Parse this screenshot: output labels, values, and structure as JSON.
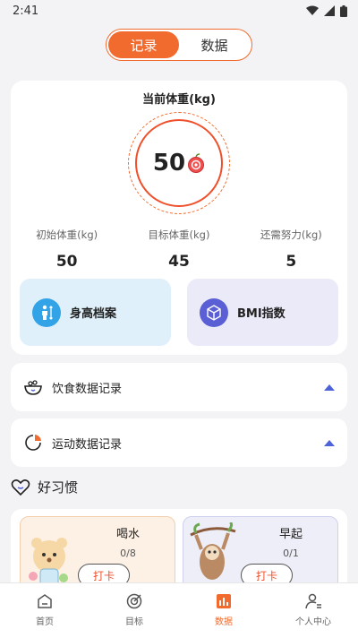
{
  "status": {
    "time": "2:41"
  },
  "segment": {
    "record_label": "记录",
    "data_label": "数据"
  },
  "weight": {
    "title": "当前体重(kg)",
    "current": "50",
    "stats": [
      {
        "label": "初始体重(kg)",
        "value": "50"
      },
      {
        "label": "目标体重(kg)",
        "value": "45"
      },
      {
        "label": "还需努力(kg)",
        "value": "5"
      }
    ]
  },
  "tiles": {
    "height_label": "身高档案",
    "bmi_label": "BMI指数"
  },
  "records": {
    "diet_label": "饮食数据记录",
    "exercise_label": "运动数据记录"
  },
  "habits": {
    "title": "好习惯",
    "items": [
      {
        "name": "喝水",
        "count": "0/8",
        "button": "打卡"
      },
      {
        "name": "早起",
        "count": "0/1",
        "button": "打卡"
      }
    ]
  },
  "tabbar": {
    "items": [
      {
        "label": "首页"
      },
      {
        "label": "目标"
      },
      {
        "label": "数据"
      },
      {
        "label": "个人中心"
      }
    ]
  },
  "colors": {
    "accent": "#f26b2e",
    "ring": "#ef4f2a",
    "triangle": "#4f63d8"
  }
}
